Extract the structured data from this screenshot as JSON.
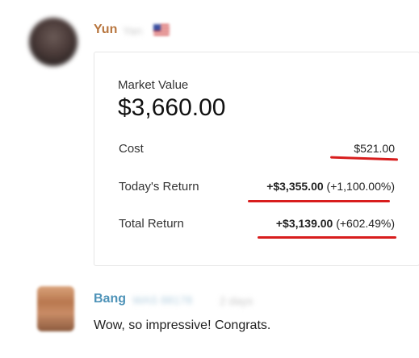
{
  "post": {
    "author": "Yun",
    "author_blurred": "Yan",
    "card": {
      "market_value_label": "Market Value",
      "market_value": "$3,660.00",
      "rows": [
        {
          "label": "Cost",
          "value": "$521.00",
          "pct": ""
        },
        {
          "label": "Today's Return",
          "value": "+$3,355.00",
          "pct": "(+1,100.00%)"
        },
        {
          "label": "Total Return",
          "value": "+$3,139.00",
          "pct": "(+602.49%)"
        }
      ]
    }
  },
  "reply": {
    "author": "Bang",
    "author_blurred": "WAS 88178",
    "meta_blurred": "2 days",
    "message": "Wow, so impressive! Congrats."
  },
  "colors": {
    "yun_name": "#b8763f",
    "bang_name": "#4e93b8",
    "annotation_red": "#d81d1d"
  }
}
